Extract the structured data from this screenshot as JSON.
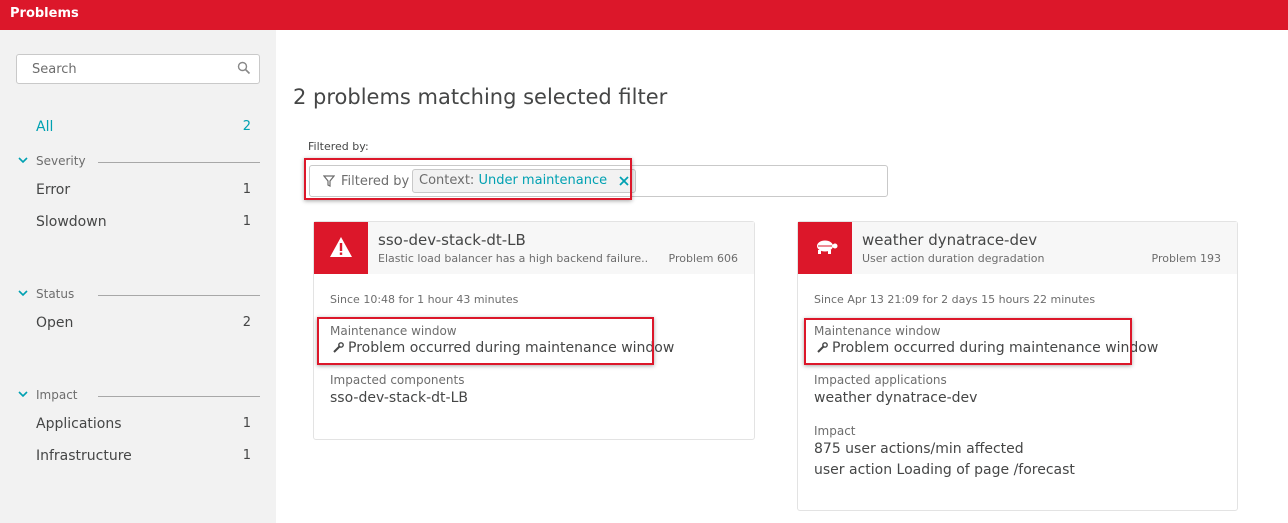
{
  "app": {
    "title": "Problems"
  },
  "sidebar": {
    "search_placeholder": "Search",
    "all": {
      "label": "All",
      "count": "2"
    },
    "groups": [
      {
        "title": "Severity",
        "items": [
          {
            "label": "Error",
            "count": "1"
          },
          {
            "label": "Slowdown",
            "count": "1"
          }
        ]
      },
      {
        "title": "Status",
        "items": [
          {
            "label": "Open",
            "count": "2"
          }
        ]
      },
      {
        "title": "Impact",
        "items": [
          {
            "label": "Applications",
            "count": "1"
          },
          {
            "label": "Infrastructure",
            "count": "1"
          }
        ]
      }
    ]
  },
  "main": {
    "heading": "2 problems matching selected filter",
    "filtered_by_label": "Filtered by:",
    "filter": {
      "prefix": "Filtered by",
      "chip_key": "Context:",
      "chip_value": "Under maintenance"
    },
    "cards": [
      {
        "title": "sso-dev-stack-dt-LB",
        "subtitle": "Elastic load balancer has a high backend failure...",
        "problem": "Problem 606",
        "since": "Since 10:48 for 1 hour 43 minutes",
        "maintenance_label": "Maintenance window",
        "maintenance_text": "Problem occurred during maintenance window",
        "impacted_label": "Impacted components",
        "impacted_value": "sso-dev-stack-dt-LB",
        "icon": "warning-triangle-icon"
      },
      {
        "title": "weather dynatrace-dev",
        "subtitle": "User action duration degradation",
        "problem": "Problem 193",
        "since": "Since Apr 13 21:09 for 2 days 15 hours 22 minutes",
        "maintenance_label": "Maintenance window",
        "maintenance_text": "Problem occurred during maintenance window",
        "impacted_label": "Impacted applications",
        "impacted_value": "weather dynatrace-dev",
        "impact_label": "Impact",
        "impact_lines": [
          "875 user actions/min affected",
          "user action Loading of page /forecast"
        ],
        "icon": "turtle-icon"
      }
    ]
  },
  "colors": {
    "brand": "#dc172a",
    "accent": "#00a1b2",
    "sidebar_bg": "#f2f2f2"
  }
}
